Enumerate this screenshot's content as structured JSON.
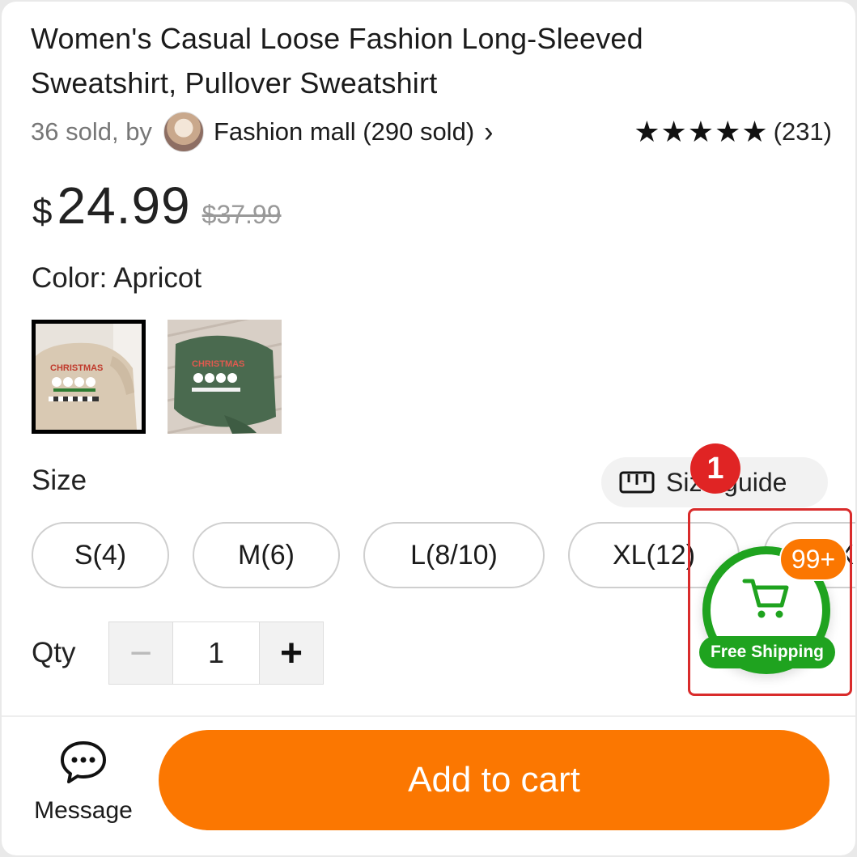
{
  "product": {
    "title": "Women's Casual Loose Fashion Long-Sleeved Sweatshirt, Pullover Sweatshirt",
    "sold": "36 sold, by",
    "seller": "Fashion mall (290 sold)",
    "stars": "★★★★★",
    "rating_count": "(231)",
    "currency": "$",
    "price": "24.99",
    "original_price": "$37.99"
  },
  "color": {
    "label": "Color: Apricot",
    "swatches": [
      "Apricot",
      "Green"
    ]
  },
  "size": {
    "label": "Size",
    "guide_label": "Size guide",
    "options": [
      "S(4)",
      "M(6)",
      "L(8/10)",
      "XL(12)",
      "X"
    ]
  },
  "qty": {
    "label": "Qty",
    "minus": "−",
    "value": "1",
    "plus": "+"
  },
  "annotation": {
    "number": "1"
  },
  "cart_float": {
    "badge": "99+",
    "free_shipping": "Free Shipping"
  },
  "bottom": {
    "message_label": "Message",
    "add_to_cart": "Add to cart"
  },
  "colors": {
    "accent_orange": "#fb7701",
    "green": "#1fa31f",
    "annotation_red": "#d92b2b"
  }
}
